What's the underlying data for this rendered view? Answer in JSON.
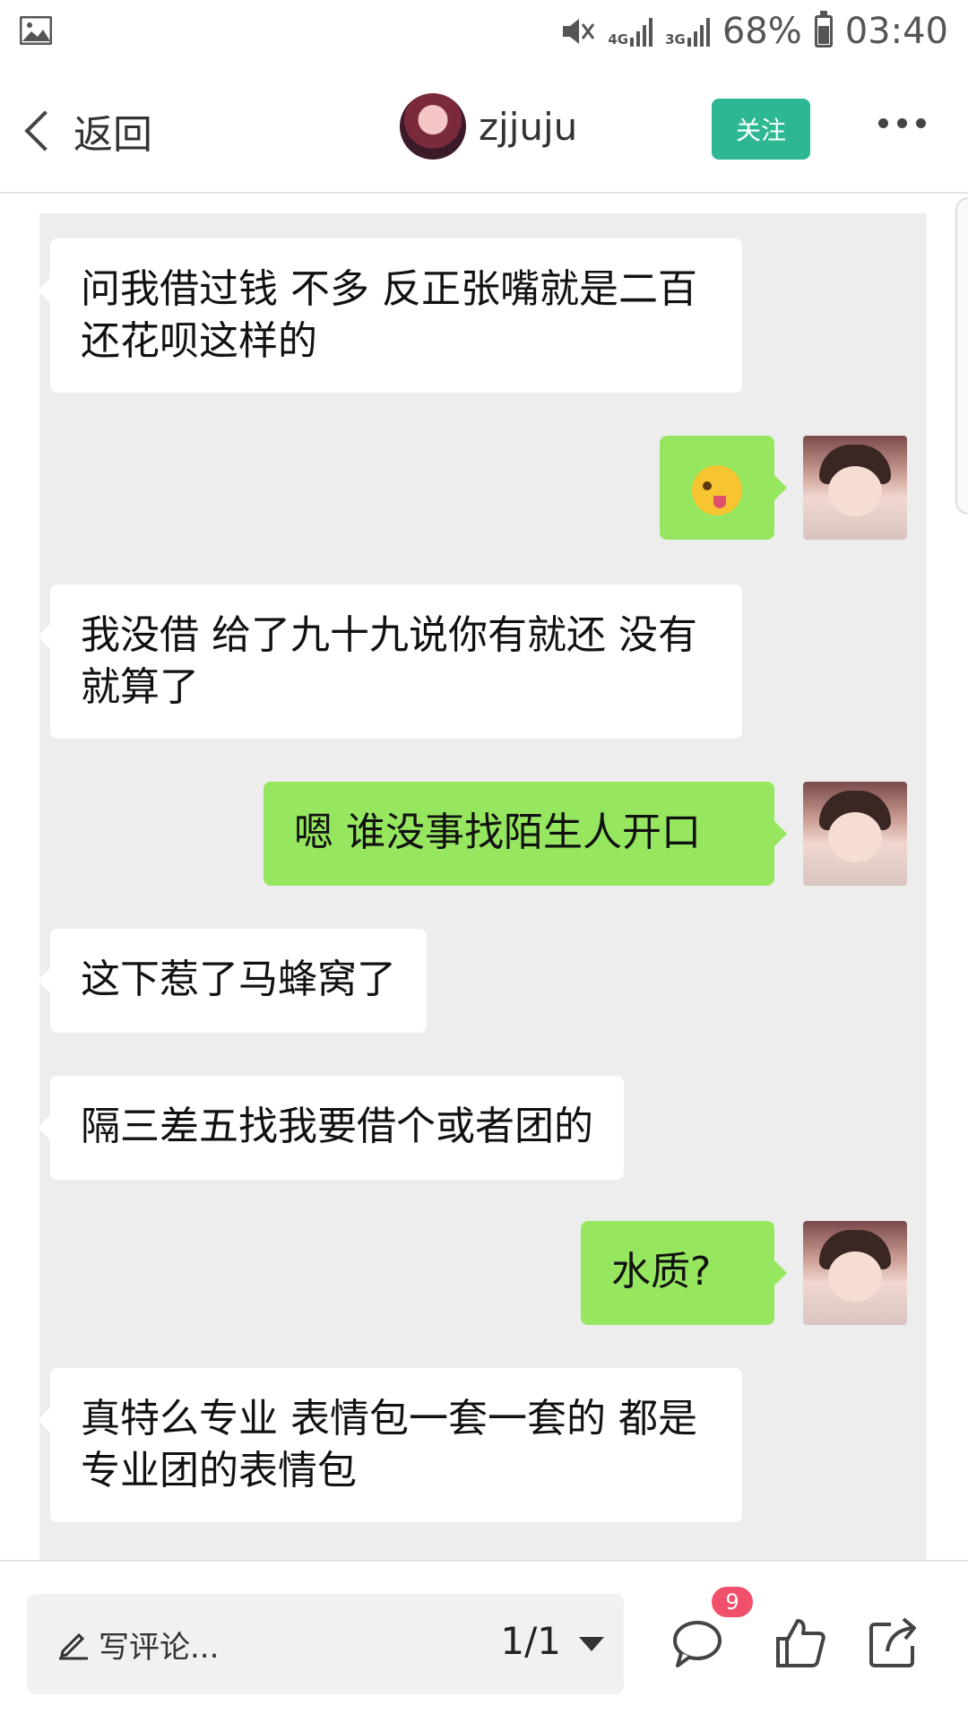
{
  "status_bar": {
    "network_a": "4G",
    "network_b": "3G",
    "battery": "68%",
    "time": "03:40",
    "battery_level": 0.68
  },
  "header": {
    "back_label": "返回",
    "username": "zjjuju",
    "follow_label": "关注"
  },
  "messages": [
    {
      "side": "in",
      "text": "问我借过钱 不多 反正张嘴就是二百还花呗这样的"
    },
    {
      "side": "out",
      "text": "",
      "emoji": "winking-tongue-emoji"
    },
    {
      "side": "in",
      "text": "我没借 给了九十九说你有就还 没有就算了"
    },
    {
      "side": "out",
      "text": "嗯 谁没事找陌生人开口"
    },
    {
      "side": "in",
      "text": "这下惹了马蜂窝了"
    },
    {
      "side": "in",
      "text": "隔三差五找我要借个或者团的"
    },
    {
      "side": "out",
      "text": "水质?"
    },
    {
      "side": "in",
      "text": "真特么专业 表情包一套一套的 都是专业团的表情包"
    }
  ],
  "bottom_bar": {
    "comment_placeholder": "写评论...",
    "pager": "1/1",
    "comment_count": "9"
  },
  "colors": {
    "accent": "#2db893",
    "bubble_out": "#96e660",
    "badge": "#f0506a"
  }
}
